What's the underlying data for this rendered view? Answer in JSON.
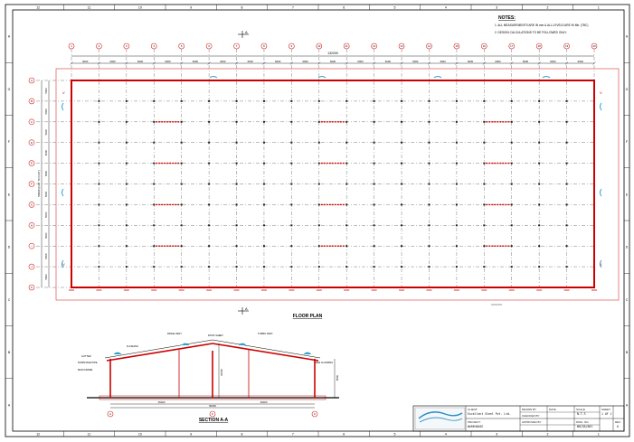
{
  "border": {
    "columns": [
      "12",
      "11",
      "10",
      "9",
      "8",
      "7",
      "6",
      "5",
      "4",
      "3",
      "2",
      "1"
    ],
    "rows": [
      "H",
      "G",
      "F",
      "E",
      "D",
      "C",
      "B",
      "A"
    ]
  },
  "notes": {
    "title": "NOTES:",
    "lines": [
      "1. ALL MEASUREMENTS ARE IN mm & ALL LEVELS ARE IN Mtr. (TBC)",
      "2. DESIGN CALCULATIONS TO BE FOLLOWED ONLY."
    ]
  },
  "plan": {
    "title": "FLOOR PLAN",
    "section_marker": "A",
    "overall_dim": "132000",
    "grid_bubbles": [
      "1",
      "2",
      "3",
      "4",
      "5",
      "6",
      "7",
      "8",
      "9",
      "10",
      "11",
      "12",
      "13",
      "14",
      "15",
      "16",
      "17",
      "18",
      "19",
      "20"
    ],
    "bay_dims": [
      "6000",
      "6000",
      "6000",
      "6000",
      "6000",
      "6000",
      "6000",
      "6000",
      "6000",
      "6000",
      "6000",
      "6000",
      "6000",
      "6000",
      "6000",
      "6000",
      "6000",
      "6000",
      "6000"
    ],
    "row_bubbles": [
      "A",
      "B",
      "C",
      "D",
      "E",
      "F",
      "G",
      "H",
      "I",
      "J",
      "K"
    ],
    "row_dims": [
      "5000",
      "5000",
      "5000",
      "5000",
      "5000",
      "5000",
      "5000",
      "5000",
      "5000",
      "5000"
    ],
    "overall_width_label": "50000 (OUT TO OUT)"
  },
  "section": {
    "title": "SECTION A-A",
    "labels": [
      "RIDGE VENT",
      "TURBO VENT",
      "FLASHING",
      "GUTTER",
      "DOWNTAKE PIPE",
      "MAIN FRAME",
      "SIDE CLADDING",
      "ROOF SHEET"
    ],
    "dims": [
      "25000",
      "25000",
      "50000"
    ],
    "height": "10000",
    "eave": "8500",
    "bubbles": [
      "A",
      "F",
      "K"
    ]
  },
  "titleblock": {
    "client_label": "CLIENT:",
    "client": "Excellent Steel Pvt. Ltd.",
    "project_label": "PROJECT:",
    "project": "WAREHOUSE",
    "drawn_label": "DRAWN BY",
    "checked_label": "CHECKED BY",
    "approved_label": "APPROVED BY",
    "date_label": "DATE",
    "scale_label": "SCALE",
    "scale": "N.T.S",
    "sheet_label": "SHEET",
    "sheet": "1 OF 1",
    "dwg_label": "DWG. NO.",
    "dwg_no": "WH/GA/001",
    "rev_label": "REV.",
    "rev": "0"
  }
}
